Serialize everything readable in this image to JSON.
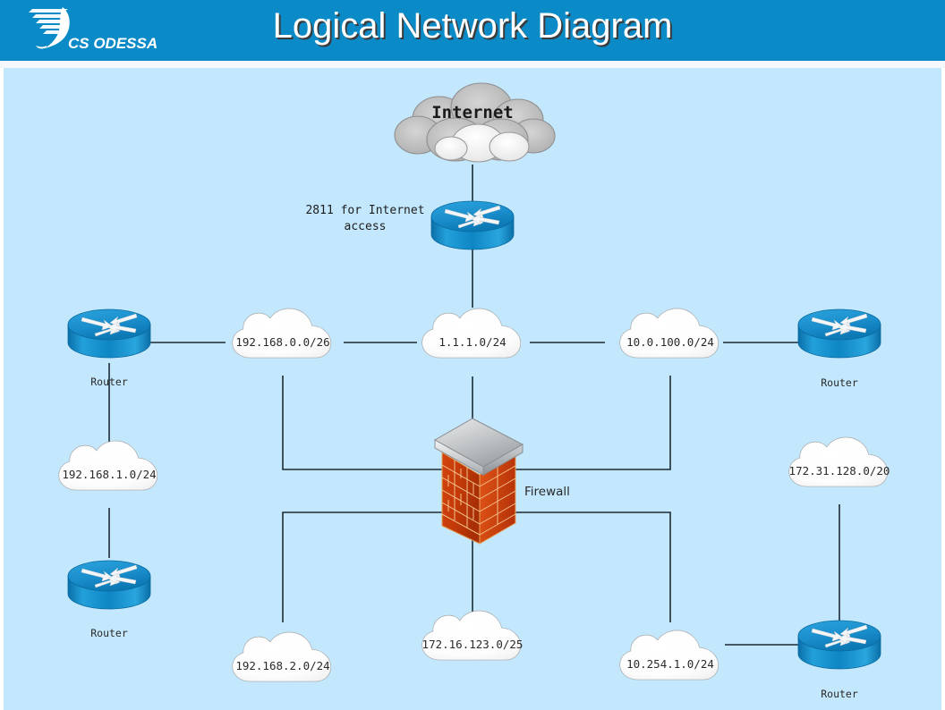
{
  "header": {
    "title": "Logical Network Diagram",
    "logo_text": "CS ODESSA",
    "background_color": "#0b8ac8",
    "title_color": "#ffffff"
  },
  "canvas": {
    "background_color": "#c3e7fc"
  },
  "diagram": {
    "type": "logical-network-diagram",
    "internet": {
      "label": "Internet",
      "icon": "cloud-icon",
      "color": "#b8b8b8"
    },
    "annotations": [
      {
        "id": "edge-router-note",
        "line1": "2811 for Internet",
        "line2": "access"
      }
    ],
    "firewall": {
      "label": "Firewall",
      "icon": "brick-wall-icon",
      "brick_color": "#c8390c",
      "cap_color": "#b9bcbe"
    },
    "routers": [
      {
        "id": "router-internet-edge",
        "label": "",
        "icon": "router-icon",
        "color": "#1b94d2"
      },
      {
        "id": "router-left-top",
        "label": "Router",
        "icon": "router-icon",
        "color": "#1b94d2"
      },
      {
        "id": "router-left-bottom",
        "label": "Router",
        "icon": "router-icon",
        "color": "#1b94d2"
      },
      {
        "id": "router-right-top",
        "label": "Router",
        "icon": "router-icon",
        "color": "#1b94d2"
      },
      {
        "id": "router-right-bottom",
        "label": "Router",
        "icon": "router-icon",
        "color": "#1b94d2"
      }
    ],
    "networks": [
      {
        "id": "net-192-168-0-0-26",
        "label": "192.168.0.0/26",
        "icon": "cloud-icon"
      },
      {
        "id": "net-1-1-1-0-24",
        "label": "1.1.1.0/24",
        "icon": "cloud-icon"
      },
      {
        "id": "net-10-0-100-0-24",
        "label": "10.0.100.0/24",
        "icon": "cloud-icon"
      },
      {
        "id": "net-192-168-1-0-24",
        "label": "192.168.1.0/24",
        "icon": "cloud-icon"
      },
      {
        "id": "net-172-31-128-0-20",
        "label": "172.31.128.0/20",
        "icon": "cloud-icon"
      },
      {
        "id": "net-192-168-2-0-24",
        "label": "192.168.2.0/24",
        "icon": "cloud-icon"
      },
      {
        "id": "net-172-16-123-0-25",
        "label": "172.16.123.0/25",
        "icon": "cloud-icon"
      },
      {
        "id": "net-10-254-1-0-24",
        "label": "10.254.1.0/24",
        "icon": "cloud-icon"
      }
    ],
    "connections": [
      {
        "from": "internet",
        "to": "router-internet-edge"
      },
      {
        "from": "router-internet-edge",
        "to": "net-1-1-1-0-24"
      },
      {
        "from": "net-1-1-1-0-24",
        "to": "net-192-168-0-0-26"
      },
      {
        "from": "net-1-1-1-0-24",
        "to": "net-10-0-100-0-24"
      },
      {
        "from": "net-1-1-1-0-24",
        "to": "firewall"
      },
      {
        "from": "net-192-168-0-0-26",
        "to": "router-left-top"
      },
      {
        "from": "net-192-168-0-0-26",
        "to": "firewall"
      },
      {
        "from": "net-10-0-100-0-24",
        "to": "router-right-top"
      },
      {
        "from": "net-10-0-100-0-24",
        "to": "firewall"
      },
      {
        "from": "router-left-top",
        "to": "net-192-168-1-0-24"
      },
      {
        "from": "net-192-168-1-0-24",
        "to": "router-left-bottom"
      },
      {
        "from": "firewall",
        "to": "net-192-168-2-0-24"
      },
      {
        "from": "firewall",
        "to": "net-172-16-123-0-25"
      },
      {
        "from": "firewall",
        "to": "net-10-254-1-0-24"
      },
      {
        "from": "net-10-254-1-0-24",
        "to": "router-right-bottom"
      },
      {
        "from": "router-right-bottom",
        "to": "net-172-31-128-0-20"
      }
    ]
  }
}
